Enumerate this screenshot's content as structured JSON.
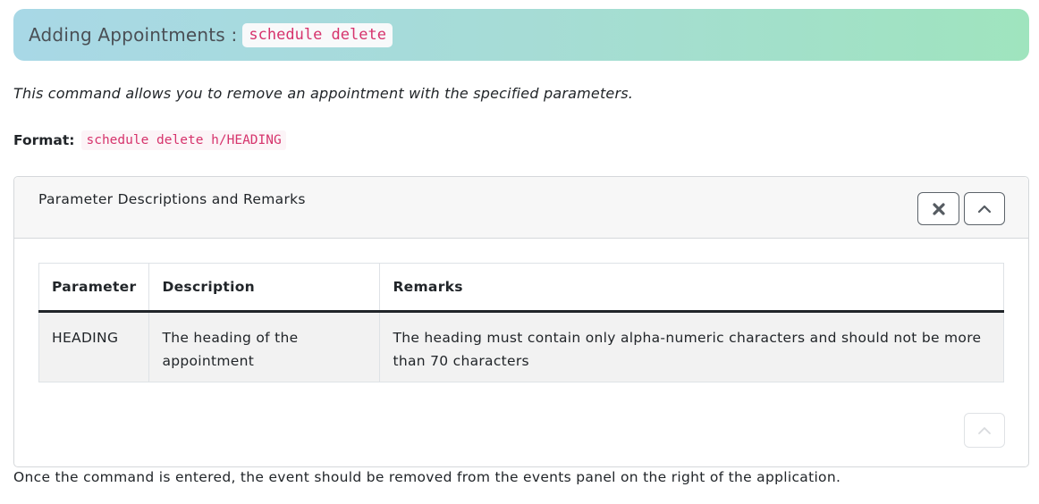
{
  "header": {
    "title": "Adding Appointments :",
    "command": "schedule delete"
  },
  "intro": "This command allows you to remove an appointment with the specified parameters.",
  "format": {
    "label": "Format:",
    "code": "schedule delete h/HEADING"
  },
  "panel": {
    "title": "Parameter Descriptions and Remarks",
    "close_icon": "close-icon",
    "collapse_icon": "chevron-up-icon",
    "table": {
      "headers": [
        "Parameter",
        "Description",
        "Remarks"
      ],
      "rows": [
        {
          "parameter": "HEADING",
          "description": "The heading of the appointment",
          "remarks": "The heading must contain only alpha-numeric characters and should not be more than 70 characters"
        }
      ]
    }
  },
  "outro": "Once the command is entered, the event should be removed from the events panel on the right of the application.",
  "colors": {
    "code_text": "#d6336c",
    "header_gradient_start": "#a8d8e6",
    "header_gradient_end": "#9fe4be",
    "table_row_bg": "#f2f2f2"
  }
}
